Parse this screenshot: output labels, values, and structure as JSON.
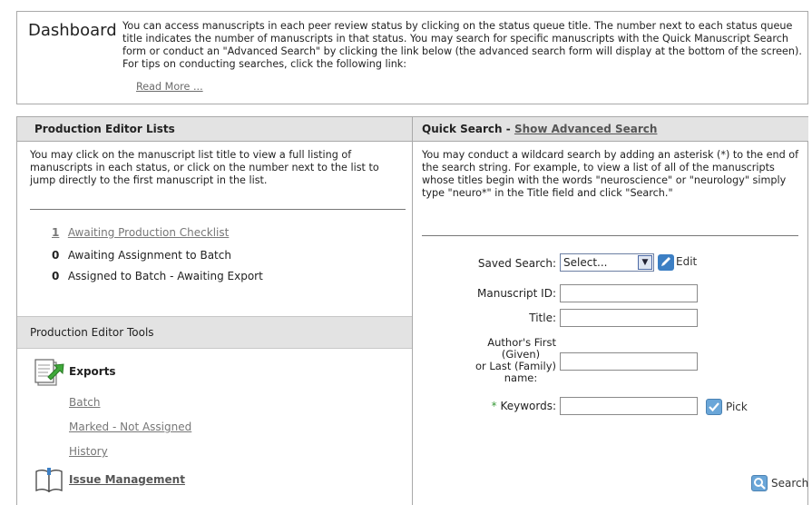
{
  "dashboard": {
    "title": "Dashboard",
    "intro": "You can access manuscripts in each peer review status by clicking on the status queue title. The number next to each status queue title indicates the number of manuscripts in that status. You may search for specific manuscripts with the Quick Manuscript Search form or conduct an \"Advanced Search\" by clicking the link below (the advanced search form will display at the bottom of the screen). For tips on conducting searches, click the following link:",
    "read_more": "Read More ..."
  },
  "production_lists": {
    "header": "Production Editor Lists",
    "description": "You may click on the manuscript list title to view a full listing of manuscripts in each status, or click on the number next to the list to jump directly to the first manuscript in the list.",
    "items": [
      {
        "count": "1",
        "label": "Awaiting Production Checklist",
        "is_link": true
      },
      {
        "count": "0",
        "label": "Awaiting Assignment to Batch",
        "is_link": false
      },
      {
        "count": "0",
        "label": "Assigned to Batch - Awaiting Export",
        "is_link": false
      }
    ]
  },
  "production_tools": {
    "header": "Production Editor Tools",
    "exports_label": "Exports",
    "export_links": [
      "Batch",
      "Marked - Not Assigned",
      "History"
    ],
    "issue_management": "Issue Management"
  },
  "quick_search": {
    "header": "Quick Search",
    "separator": " - ",
    "advanced_link": "Show Advanced Search",
    "description": "You may conduct a wildcard search by adding an asterisk (*) to the end of the search string. For example, to view a list of all of the manuscripts whose titles begin with the words \"neuroscience\" or \"neurology\" simply type \"neuro*\" in the Title field and click \"Search.\"",
    "saved_search_label": "Saved Search:",
    "saved_search_value": "Select...",
    "edit_label": "Edit",
    "manuscript_id_label": "Manuscript ID:",
    "manuscript_id_value": "",
    "title_label": "Title:",
    "title_value": "",
    "author_label_l1": "Author's First",
    "author_label_l2": "(Given)",
    "author_label_l3": "or Last (Family)",
    "author_label_l4": "name:",
    "author_value": "",
    "required_mark": "*",
    "keywords_label": "Keywords:",
    "keywords_value": "",
    "pick_label": "Pick",
    "search_label": "Search"
  },
  "colors": {
    "header_bg": "#e3e3e3",
    "border": "#a9a9a9",
    "link_gray": "#777777",
    "required_green": "#3a9a3a",
    "icon_blue": "#3c7fc4"
  }
}
